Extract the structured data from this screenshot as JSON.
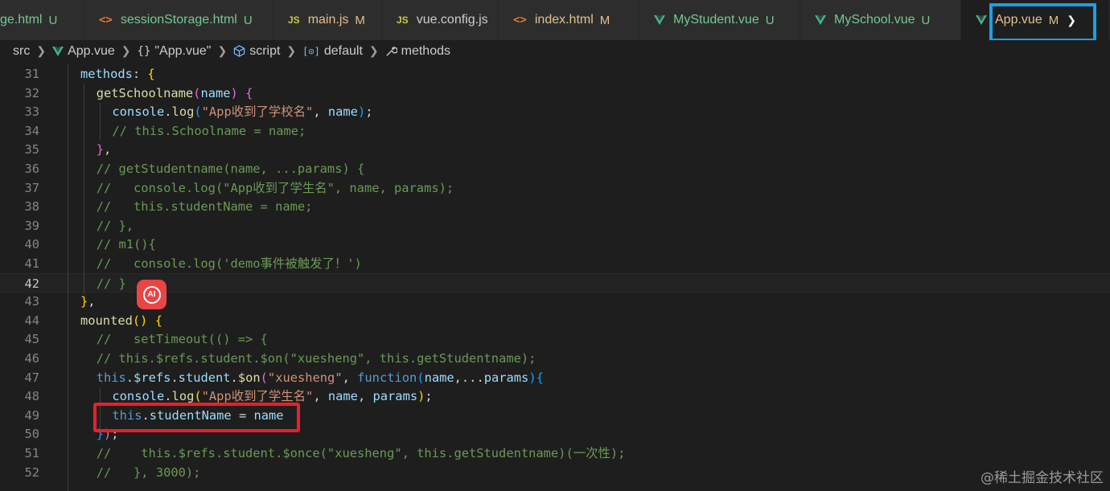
{
  "tabs": [
    {
      "name": "ge.html",
      "status": "U",
      "icon": "html-file-icon",
      "color": "U"
    },
    {
      "name": "sessionStorage.html",
      "status": "U",
      "icon": "html-file-icon",
      "color": "U"
    },
    {
      "name": "main.js",
      "status": "M",
      "icon": "js-file-icon",
      "color": "M"
    },
    {
      "name": "vue.config.js",
      "status": "",
      "icon": "js-file-icon",
      "color": "plain"
    },
    {
      "name": "index.html",
      "status": "M",
      "icon": "html-file-icon",
      "color": "M"
    },
    {
      "name": "MyStudent.vue",
      "status": "U",
      "icon": "vue-file-icon",
      "color": "U"
    },
    {
      "name": "MySchool.vue",
      "status": "U",
      "icon": "vue-file-icon",
      "color": "U"
    },
    {
      "name": "App.vue",
      "status": "M",
      "icon": "vue-file-icon",
      "color": "M",
      "active": true
    }
  ],
  "tab_icon_text": {
    "html": "<>",
    "js": "JS"
  },
  "breadcrumb": {
    "src": "src",
    "file": "App.vue",
    "module": "\"App.vue\"",
    "script": "script",
    "default": "default",
    "methods": "methods"
  },
  "editor": {
    "current_line": 42,
    "lines": [
      {
        "n": 31,
        "indent": 1,
        "tokens": [
          [
            "prop",
            "methods"
          ],
          [
            "pun",
            ": "
          ],
          [
            "br1",
            "{"
          ]
        ]
      },
      {
        "n": 32,
        "indent": 2,
        "tokens": [
          [
            "fn",
            "getSchoolname"
          ],
          [
            "br2",
            "("
          ],
          [
            "prop",
            "name"
          ],
          [
            "br2",
            ")"
          ],
          [
            "pun",
            " "
          ],
          [
            "br2",
            "{"
          ]
        ]
      },
      {
        "n": 33,
        "indent": 3,
        "tokens": [
          [
            "prop",
            "console"
          ],
          [
            "pun",
            "."
          ],
          [
            "fn",
            "log"
          ],
          [
            "br3",
            "("
          ],
          [
            "str",
            "\"App收到了学校名\""
          ],
          [
            "pun",
            ", "
          ],
          [
            "prop",
            "name"
          ],
          [
            "br3",
            ")"
          ],
          [
            "pun",
            ";"
          ]
        ]
      },
      {
        "n": 34,
        "indent": 3,
        "tokens": [
          [
            "com",
            "// this.Schoolname = name;"
          ]
        ]
      },
      {
        "n": 35,
        "indent": 2,
        "tokens": [
          [
            "br2",
            "}"
          ],
          [
            "pun",
            ","
          ]
        ]
      },
      {
        "n": 36,
        "indent": 2,
        "tokens": [
          [
            "com",
            "// getStudentname(name, ...params) {"
          ]
        ]
      },
      {
        "n": 37,
        "indent": 2,
        "tokens": [
          [
            "com",
            "//   console.log(\"App收到了学生名\", name, params);"
          ]
        ]
      },
      {
        "n": 38,
        "indent": 2,
        "tokens": [
          [
            "com",
            "//   this.studentName = name;"
          ]
        ]
      },
      {
        "n": 39,
        "indent": 2,
        "tokens": [
          [
            "com",
            "// },"
          ]
        ]
      },
      {
        "n": 40,
        "indent": 2,
        "tokens": [
          [
            "com",
            "// m1(){"
          ]
        ]
      },
      {
        "n": 41,
        "indent": 2,
        "tokens": [
          [
            "com",
            "//   console.log('demo事件被触发了！')"
          ]
        ]
      },
      {
        "n": 42,
        "indent": 2,
        "tokens": [
          [
            "com",
            "// }"
          ]
        ]
      },
      {
        "n": 43,
        "indent": 1,
        "tokens": [
          [
            "br1",
            "}"
          ],
          [
            "pun",
            ","
          ]
        ]
      },
      {
        "n": 44,
        "indent": 1,
        "tokens": [
          [
            "fn",
            "mounted"
          ],
          [
            "br1",
            "()"
          ],
          [
            "pun",
            " "
          ],
          [
            "br1",
            "{"
          ]
        ]
      },
      {
        "n": 45,
        "indent": 2,
        "tokens": [
          [
            "com",
            "//   setTimeout(() => {"
          ]
        ]
      },
      {
        "n": 46,
        "indent": 2,
        "tokens": [
          [
            "com",
            "// this.$refs.student.$on(\"xuesheng\", this.getStudentname);"
          ]
        ]
      },
      {
        "n": 47,
        "indent": 2,
        "tokens": [
          [
            "kw",
            "this"
          ],
          [
            "pun",
            "."
          ],
          [
            "prop",
            "$refs"
          ],
          [
            "pun",
            "."
          ],
          [
            "prop",
            "student"
          ],
          [
            "pun",
            "."
          ],
          [
            "fn",
            "$on"
          ],
          [
            "br2",
            "("
          ],
          [
            "str",
            "\"xuesheng\""
          ],
          [
            "pun",
            ", "
          ],
          [
            "kw",
            "function"
          ],
          [
            "br3",
            "("
          ],
          [
            "prop",
            "name"
          ],
          [
            "pun",
            ",..."
          ],
          [
            "prop",
            "params"
          ],
          [
            "br3",
            ")"
          ],
          [
            "br3",
            "{"
          ]
        ]
      },
      {
        "n": 48,
        "indent": 3,
        "tokens": [
          [
            "prop",
            "console"
          ],
          [
            "pun",
            "."
          ],
          [
            "fn",
            "log"
          ],
          [
            "br1",
            "("
          ],
          [
            "str",
            "\"App收到了学生名\""
          ],
          [
            "pun",
            ", "
          ],
          [
            "prop",
            "name"
          ],
          [
            "pun",
            ", "
          ],
          [
            "prop",
            "params"
          ],
          [
            "br1",
            ")"
          ],
          [
            "pun",
            ";"
          ]
        ]
      },
      {
        "n": 49,
        "indent": 3,
        "tokens": [
          [
            "kw",
            "this"
          ],
          [
            "pun",
            "."
          ],
          [
            "prop",
            "studentName"
          ],
          [
            "pun",
            " = "
          ],
          [
            "prop",
            "name"
          ]
        ]
      },
      {
        "n": 50,
        "indent": 2,
        "tokens": [
          [
            "br3",
            "}"
          ],
          [
            "br2",
            ")"
          ],
          [
            "pun",
            ";"
          ]
        ]
      },
      {
        "n": 51,
        "indent": 2,
        "tokens": [
          [
            "com",
            "//    this.$refs.student.$once(\"xuesheng\", this.getStudentname)(一次性);"
          ]
        ]
      },
      {
        "n": 52,
        "indent": 2,
        "tokens": [
          [
            "com",
            "//   }, 3000);"
          ]
        ]
      }
    ]
  },
  "ai_badge_label": "AI",
  "watermark": "@稀土掘金技术社区",
  "colors": {
    "highlight_tab": "#1a9fe6",
    "highlight_code": "#e8202a",
    "ai_badge": "#ea4444"
  }
}
